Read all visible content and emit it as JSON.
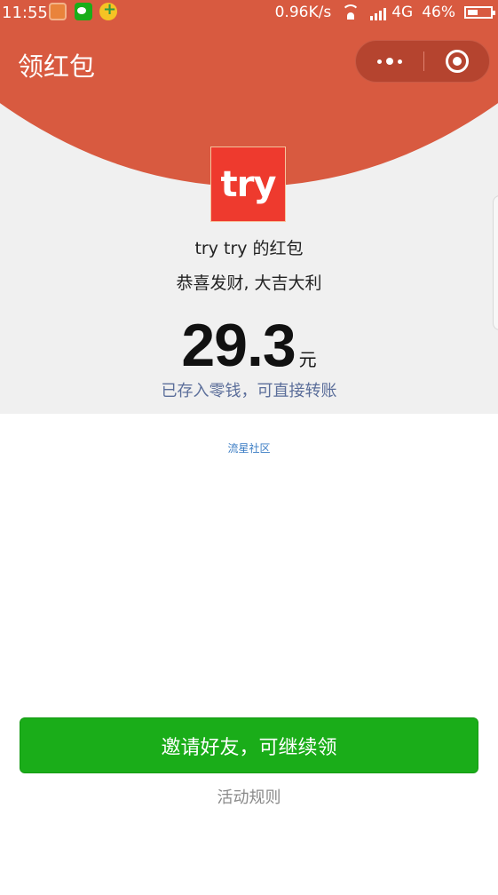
{
  "status_bar": {
    "time": "11:55",
    "network_speed": "0.96K/s",
    "network_type": "4G",
    "battery": "46%",
    "battery_level": 0.46
  },
  "header": {
    "title": "领红包",
    "accent_color": "#d85a40"
  },
  "avatar": {
    "text": "try",
    "color": "#ee3a2e"
  },
  "redpacket": {
    "sender": "try try 的红包",
    "greeting": "恭喜发财, 大吉大利",
    "amount": "29.3",
    "currency": "元",
    "saved_note": "已存入零钱，可直接转账"
  },
  "footer": {
    "community_link": "流星社区",
    "invite_button": "邀请好友，可继续领",
    "rules_link": "活动规则",
    "button_color": "#1aad19"
  }
}
